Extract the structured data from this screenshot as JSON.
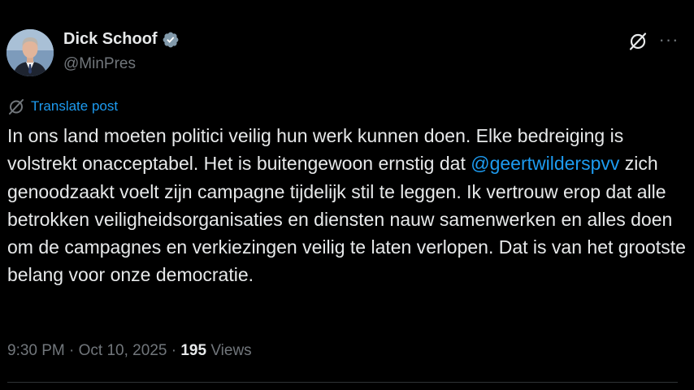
{
  "author": {
    "name": "Dick Schoof",
    "handle": "@MinPres",
    "verified": true,
    "verified_badge_color": "#829aab"
  },
  "actions": {
    "grok_icon": "slashed-circle-icon",
    "more_label": "···"
  },
  "translate": {
    "label": "Translate post",
    "icon": "slashed-circle-icon"
  },
  "post": {
    "text_before_mention": "In ons land moeten politici veilig hun werk kunnen doen. Elke bedreiging is volstrekt onacceptabel. Het is buitengewoon ernstig dat ",
    "mention": "@geertwilderspvv",
    "text_after_mention": " zich genoodzaakt voelt zijn campagne tijdelijk stil te leggen. Ik vertrouw erop dat alle betrokken veiligheidsorganisaties en diensten nauw samenwerken en alles doen om de campagnes en verkiezingen veilig te laten verlopen. Dat is van het grootste belang voor onze democratie."
  },
  "meta": {
    "time": "9:30 PM",
    "separator": " · ",
    "date": "Oct 10, 2025",
    "views_count": "195",
    "views_label": " Views"
  },
  "colors": {
    "background": "#000000",
    "text": "#e7e9ea",
    "secondary": "#71767b",
    "link": "#1d9bf0",
    "divider": "#2f3336"
  }
}
